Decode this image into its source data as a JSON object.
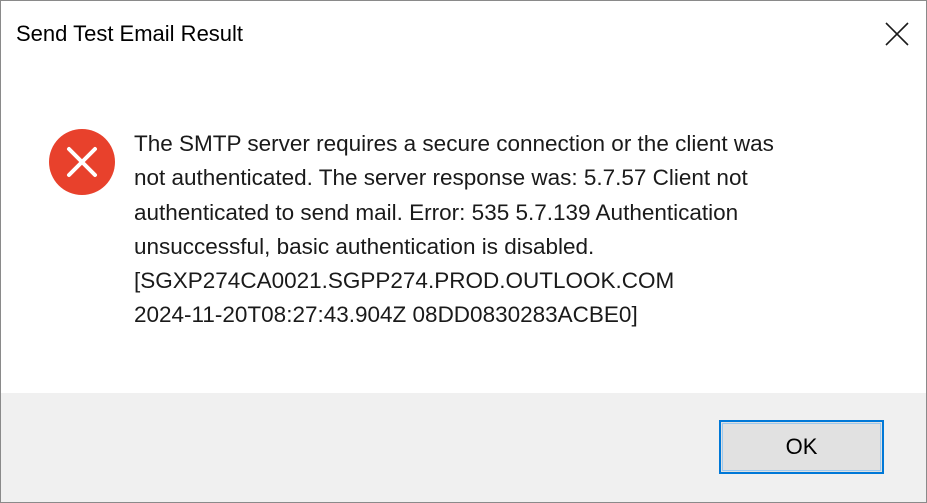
{
  "window": {
    "title": "Send Test Email Result",
    "close_icon": "close-icon"
  },
  "message": {
    "icon": "error-icon",
    "icon_color": "#e8412c",
    "text": "The SMTP server requires a secure connection or the client was\nnot authenticated. The server response was: 5.7.57 Client not\nauthenticated to send mail. Error: 535 5.7.139 Authentication\nunsuccessful, basic authentication is disabled.\n[SGXP274CA0021.SGPP274.PROD.OUTLOOK.COM\n2024-11-20T08:27:43.904Z 08DD0830283ACBE0]"
  },
  "footer": {
    "ok_label": "OK",
    "accent_color": "#0078d7"
  }
}
